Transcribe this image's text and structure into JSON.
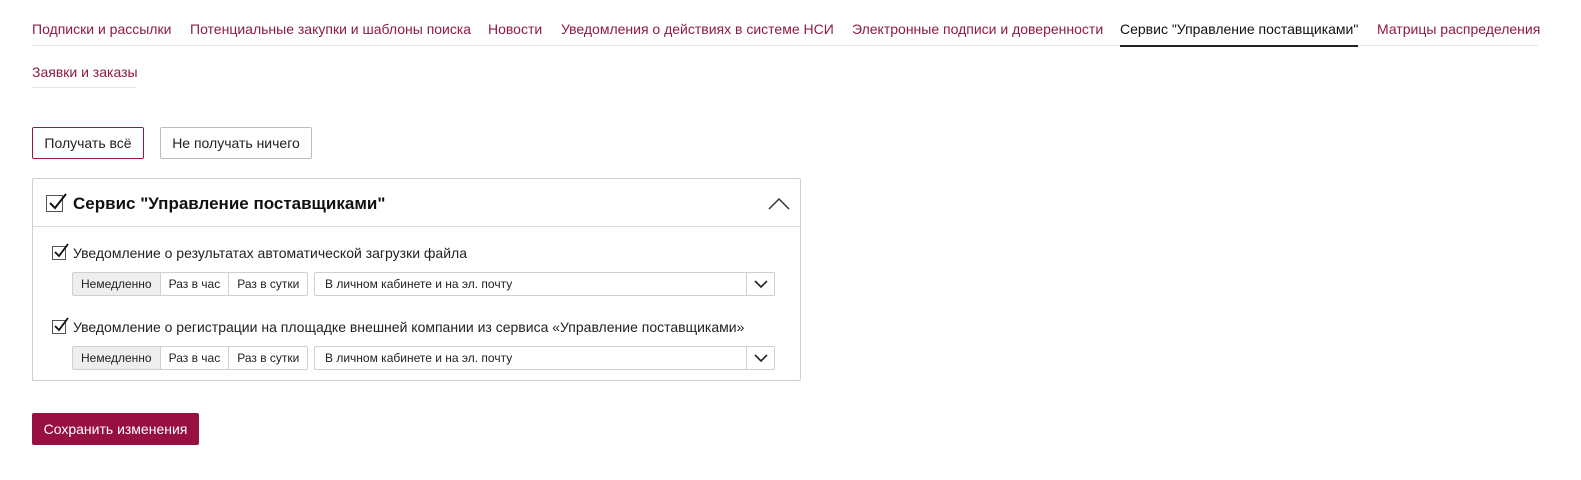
{
  "tabs": [
    {
      "label": "Подписки и рассылки",
      "active": false
    },
    {
      "label": "Потенциальные закупки и шаблоны поиска",
      "active": false
    },
    {
      "label": "Новости",
      "active": false
    },
    {
      "label": "Уведомления о действиях в системе НСИ",
      "active": false
    },
    {
      "label": "Электронные подписи и доверенности",
      "active": false
    },
    {
      "label": "Сервис \"Управление поставщиками\"",
      "active": true
    },
    {
      "label": "Матрицы распределения",
      "active": false
    },
    {
      "label": "Заявки и заказы",
      "active": false
    }
  ],
  "actions": {
    "receive_all": "Получать всё",
    "receive_none": "Не получать ничего",
    "save": "Сохранить изменения"
  },
  "panel": {
    "title": "Сервис \"Управление поставщиками\"",
    "checked": true,
    "expanded": true,
    "items": [
      {
        "label": "Уведомление о результатах автоматической загрузки файла",
        "checked": true,
        "frequency_options": [
          "Немедленно",
          "Раз в час",
          "Раз в сутки"
        ],
        "frequency_selected": "Немедленно",
        "channel": "В личном кабинете и на эл. почту"
      },
      {
        "label": "Уведомление о регистрации на площадке внешней компании из сервиса «Управление поставщиками»",
        "checked": true,
        "frequency_options": [
          "Немедленно",
          "Раз в час",
          "Раз в сутки"
        ],
        "frequency_selected": "Немедленно",
        "channel": "В личном кабинете и на эл. почту"
      }
    ]
  },
  "colors": {
    "accent": "#8f1a43",
    "save_button": "#961042",
    "active_segment": "#eeeeee"
  }
}
